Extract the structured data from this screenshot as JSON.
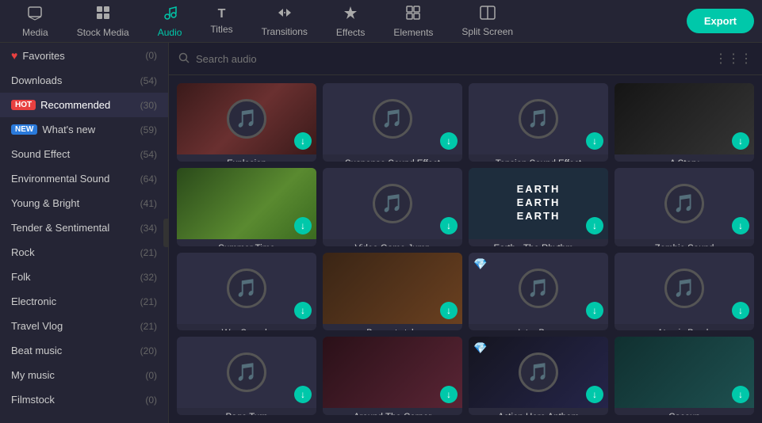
{
  "nav": {
    "items": [
      {
        "id": "media",
        "label": "Media",
        "icon": "🖥",
        "active": false
      },
      {
        "id": "stock-media",
        "label": "Stock Media",
        "icon": "🎬",
        "active": false
      },
      {
        "id": "audio",
        "label": "Audio",
        "icon": "🎵",
        "active": true
      },
      {
        "id": "titles",
        "label": "Titles",
        "icon": "T",
        "active": false
      },
      {
        "id": "transitions",
        "label": "Transitions",
        "icon": "⇄",
        "active": false
      },
      {
        "id": "effects",
        "label": "Effects",
        "icon": "✦",
        "active": false
      },
      {
        "id": "elements",
        "label": "Elements",
        "icon": "◻",
        "active": false
      },
      {
        "id": "split-screen",
        "label": "Split Screen",
        "icon": "⊞",
        "active": false
      }
    ],
    "export_label": "Export"
  },
  "sidebar": {
    "items": [
      {
        "id": "favorites",
        "label": "Favorites",
        "count": "(0)",
        "badge": "fav",
        "active": false
      },
      {
        "id": "downloads",
        "label": "Downloads",
        "count": "(54)",
        "badge": "",
        "active": false
      },
      {
        "id": "recommended",
        "label": "Recommended",
        "count": "(30)",
        "badge": "hot",
        "active": true
      },
      {
        "id": "whats-new",
        "label": "What's new",
        "count": "(59)",
        "badge": "new",
        "active": false
      },
      {
        "id": "sound-effect",
        "label": "Sound Effect",
        "count": "(54)",
        "badge": "",
        "active": false
      },
      {
        "id": "environmental-sound",
        "label": "Environmental Sound",
        "count": "(64)",
        "badge": "",
        "active": false
      },
      {
        "id": "young-bright",
        "label": "Young & Bright",
        "count": "(41)",
        "badge": "",
        "active": false
      },
      {
        "id": "tender-sentimental",
        "label": "Tender & Sentimental",
        "count": "(34)",
        "badge": "",
        "active": false
      },
      {
        "id": "rock",
        "label": "Rock",
        "count": "(21)",
        "badge": "",
        "active": false
      },
      {
        "id": "folk",
        "label": "Folk",
        "count": "(32)",
        "badge": "",
        "active": false
      },
      {
        "id": "electronic",
        "label": "Electronic",
        "count": "(21)",
        "badge": "",
        "active": false
      },
      {
        "id": "travel-vlog",
        "label": "Travel Vlog",
        "count": "(21)",
        "badge": "",
        "active": false
      },
      {
        "id": "beat-music",
        "label": "Beat music",
        "count": "(20)",
        "badge": "",
        "active": false
      },
      {
        "id": "my-music",
        "label": "My music",
        "count": "(0)",
        "badge": "",
        "active": false
      },
      {
        "id": "filmstock",
        "label": "Filmstock",
        "count": "(0)",
        "badge": "",
        "active": false
      }
    ]
  },
  "search": {
    "placeholder": "Search audio"
  },
  "audio_grid": {
    "items": [
      {
        "id": "explosion",
        "title": "Explosion",
        "thumb_type": "explosion",
        "has_image": false,
        "premium": false
      },
      {
        "id": "suspense-sound-effect",
        "title": "Suspense Sound Effect",
        "thumb_type": "default",
        "has_image": false,
        "premium": false
      },
      {
        "id": "tension-sound-effect",
        "title": "Tension Sound Effect",
        "thumb_type": "default",
        "has_image": false,
        "premium": false
      },
      {
        "id": "a-story",
        "title": "A Story",
        "thumb_type": "astory",
        "has_image": true,
        "premium": false
      },
      {
        "id": "summer-time",
        "title": "Summer Time",
        "thumb_type": "summertime",
        "has_image": true,
        "premium": false
      },
      {
        "id": "video-game-jump",
        "title": "Video Game Jump",
        "thumb_type": "default",
        "has_image": false,
        "premium": false
      },
      {
        "id": "earth-rhythm",
        "title": "Earth - The Rhythm ...",
        "thumb_type": "earth",
        "has_image": true,
        "premium": false
      },
      {
        "id": "zombie-sound",
        "title": "Zombie Sound",
        "thumb_type": "default",
        "has_image": false,
        "premium": false
      },
      {
        "id": "war-sounds",
        "title": "War Sounds",
        "thumb_type": "default",
        "has_image": false,
        "premium": false
      },
      {
        "id": "boy-got-style",
        "title": "Boy got style",
        "thumb_type": "boygot",
        "has_image": true,
        "premium": false
      },
      {
        "id": "intro-bass",
        "title": "Intro Bass",
        "thumb_type": "default",
        "has_image": false,
        "premium": true
      },
      {
        "id": "atomic-bomb",
        "title": "Atomic Bomb",
        "thumb_type": "default",
        "has_image": false,
        "premium": false
      },
      {
        "id": "page-turn",
        "title": "Page Turn",
        "thumb_type": "default",
        "has_image": false,
        "premium": false
      },
      {
        "id": "around-the-corner",
        "title": "Around The Corner",
        "thumb_type": "around",
        "has_image": true,
        "premium": false
      },
      {
        "id": "action-hero-anthem",
        "title": "Action Hero Anthem",
        "thumb_type": "action",
        "has_image": false,
        "premium": true
      },
      {
        "id": "cacoun",
        "title": "Cacoun",
        "thumb_type": "cacoun",
        "has_image": true,
        "premium": false
      }
    ]
  }
}
